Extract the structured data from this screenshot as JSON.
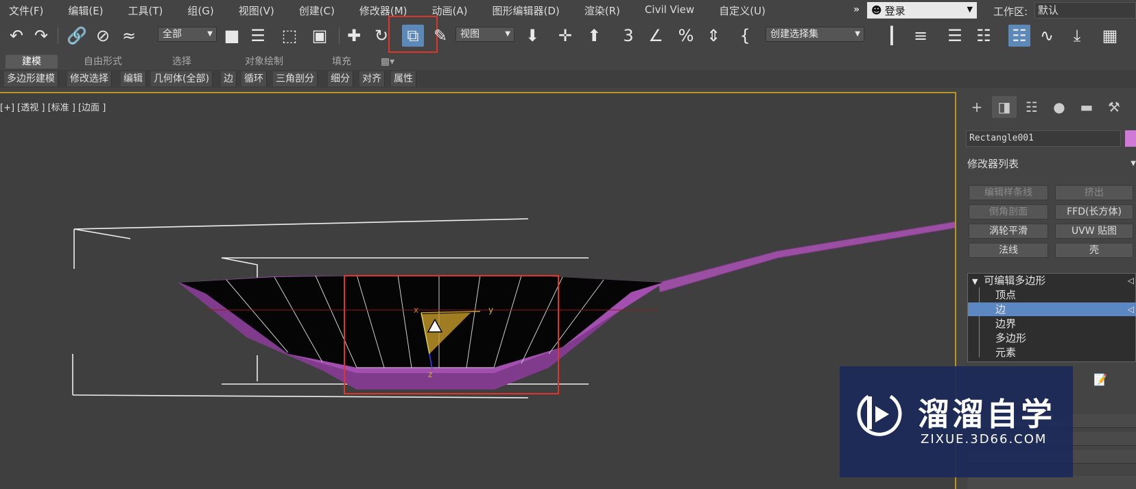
{
  "menu": [
    "文件(F)",
    "编辑(E)",
    "工具(T)",
    "组(G)",
    "视图(V)",
    "创建(C)",
    "修改器(M)",
    "动画(A)",
    "图形编辑器(D)",
    "渲染(R)",
    "Civil View",
    "自定义(U)"
  ],
  "menu_more": "»",
  "login": "登录",
  "workspace_label": "工作区:",
  "workspace_value": "默认",
  "toolbar": {
    "selection_filter": "全部",
    "ref_coord": "视图",
    "named_selection": "创建选择集",
    "icons": {
      "undo": "undo-icon",
      "redo": "redo-icon",
      "link": "link-icon",
      "unlink": "unlink-icon",
      "bind_space_warp": "bind-space-warp-icon",
      "select_object": "select-object-icon",
      "select_by_name": "select-by-name-icon",
      "rect_region": "rect-region-icon",
      "window_crossing": "window-crossing-icon",
      "move": "move-icon",
      "rotate": "rotate-icon",
      "scale": "scale-icon",
      "placement": "placement-icon",
      "pivot": "pivot-center-icon",
      "manipulate": "manipulate-icon",
      "keyboard_shortcut": "keyboard-shortcut-icon",
      "snap_3d": "snap-3d-icon",
      "angle_snap": "angle-snap-icon",
      "percent_snap": "percent-snap-icon",
      "spinner_snap": "spinner-snap-icon",
      "edit_named_sets": "edit-named-sets-icon",
      "mirror": "mirror-icon",
      "align": "align-icon",
      "scene_explorer": "scene-explorer-icon",
      "layer_explorer": "layer-explorer-icon",
      "ribbon_toggle": "ribbon-toggle-icon",
      "curve_editor": "curve-editor-icon",
      "schematic": "schematic-view-icon",
      "material_editor": "material-editor-icon"
    }
  },
  "ribbon_tabs": [
    "建模",
    "自由形式",
    "选择",
    "对象绘制",
    "填充"
  ],
  "ribbon_panel": [
    "多边形建模",
    "修改选择",
    "编辑",
    "几何体(全部)",
    "边",
    "循环",
    "三角剖分",
    "细分",
    "对齐",
    "属性"
  ],
  "viewport_label": "[+] [透视 ] [标准 ] [边面 ]",
  "gizmo": {
    "x": "x",
    "y": "y",
    "z": "z"
  },
  "command_panel": {
    "tabs": [
      "create-icon",
      "modify-icon",
      "hierarchy-icon",
      "motion-icon",
      "display-icon",
      "utilities-icon"
    ],
    "object_name": "Rectangle001",
    "object_color": "#d07ad8",
    "modifier_list": "修改器列表",
    "modifier_buttons": [
      {
        "label": "编辑样条线",
        "enabled": false
      },
      {
        "label": "挤出",
        "enabled": false
      },
      {
        "label": "倒角剖面",
        "enabled": false
      },
      {
        "label": "FFD(长方体)",
        "enabled": true
      },
      {
        "label": "涡轮平滑",
        "enabled": true
      },
      {
        "label": "UVW 贴图",
        "enabled": true
      },
      {
        "label": "法线",
        "enabled": true
      },
      {
        "label": "壳",
        "enabled": true
      }
    ],
    "stack": {
      "root": "可编辑多边形",
      "subobjects": [
        "顶点",
        "边",
        "边界",
        "多边形",
        "元素"
      ],
      "selected": "边"
    }
  },
  "watermark": {
    "title": "溜溜自学",
    "url": "ZIXUE.3D66.COM"
  },
  "colors": {
    "highlight": "#e0352b",
    "viewport_border": "#b8951f",
    "selection": "#5b87c2",
    "mesh": "#9b4fa3"
  }
}
